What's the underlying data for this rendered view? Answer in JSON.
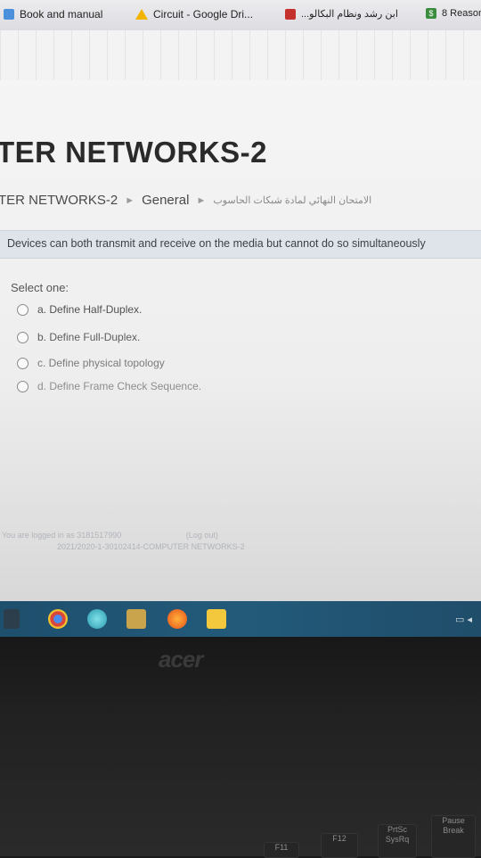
{
  "browser": {
    "bookmarks": [
      {
        "label": "Book and manual",
        "icon": "book-icon"
      },
      {
        "label": "Circuit - Google Dri...",
        "icon": "google-drive-icon"
      },
      {
        "label": "ابن رشد ونظام البكالو...",
        "icon": "youtube-icon"
      },
      {
        "label": "8 Reason",
        "icon": "s-icon"
      }
    ]
  },
  "page": {
    "course_title": "TER NETWORKS-2",
    "breadcrumb": {
      "course": "TER NETWORKS-2",
      "section": "General",
      "quiz": "الامتحان النهائي لمادة شبكات الحاسوب"
    },
    "question": {
      "text": "Devices can both transmit and receive on the media but cannot do so simultaneously",
      "prompt": "Select one:",
      "options": [
        "a. Define Half-Duplex.",
        "b. Define Full-Duplex.",
        "c. Define physical topology",
        "d. Define Frame Check Sequence."
      ]
    },
    "footer": {
      "login_line": "You are logged in as 3181517990",
      "logout_label": "(Log out)",
      "course_line": "2021/2020-1-30102414-COMPUTER NETWORKS-2"
    }
  },
  "device": {
    "brand": "acer",
    "keys": [
      "F11",
      "F12",
      "PrtSc",
      "SysRq",
      "Pause",
      "Break"
    ]
  },
  "colors": {
    "question_bg": "#dfe3ea",
    "taskbar": "#235a7a"
  }
}
